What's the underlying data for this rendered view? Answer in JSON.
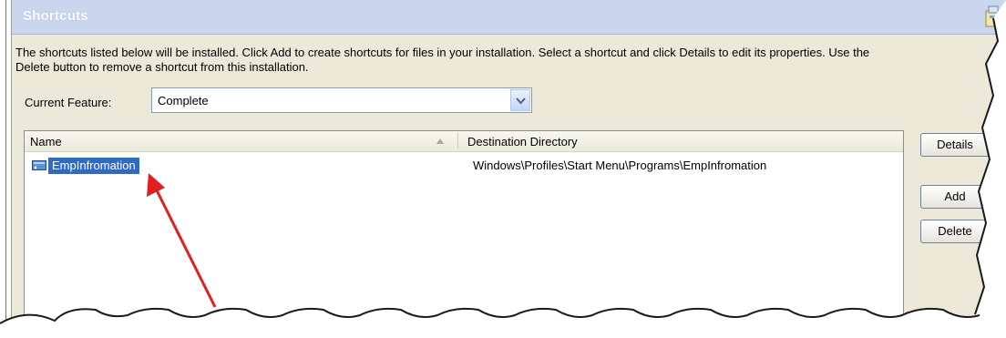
{
  "header": {
    "title": "Shortcuts",
    "icon": "installer-icon"
  },
  "description": "The shortcuts listed below will be installed. Click Add to create shortcuts for files in your installation. Select a shortcut and click Details to edit its properties. Use the\nDelete button to remove a shortcut from this installation.",
  "feature": {
    "label": "Current Feature:",
    "value": "Complete"
  },
  "table": {
    "columns": [
      "Name",
      "Destination Directory"
    ],
    "rows": [
      {
        "name": "EmpInfromation",
        "destination": "Windows\\Profiles\\Start Menu\\Programs\\EmpInfromation",
        "selected": true
      }
    ]
  },
  "buttons": {
    "details": "Details",
    "add": "Add",
    "delete": "Delete"
  },
  "colors": {
    "selection": "#316ac5",
    "header_bg": "#c9d6ee",
    "panel_bg": "#ece9d8",
    "annotation_arrow": "#e02020"
  }
}
